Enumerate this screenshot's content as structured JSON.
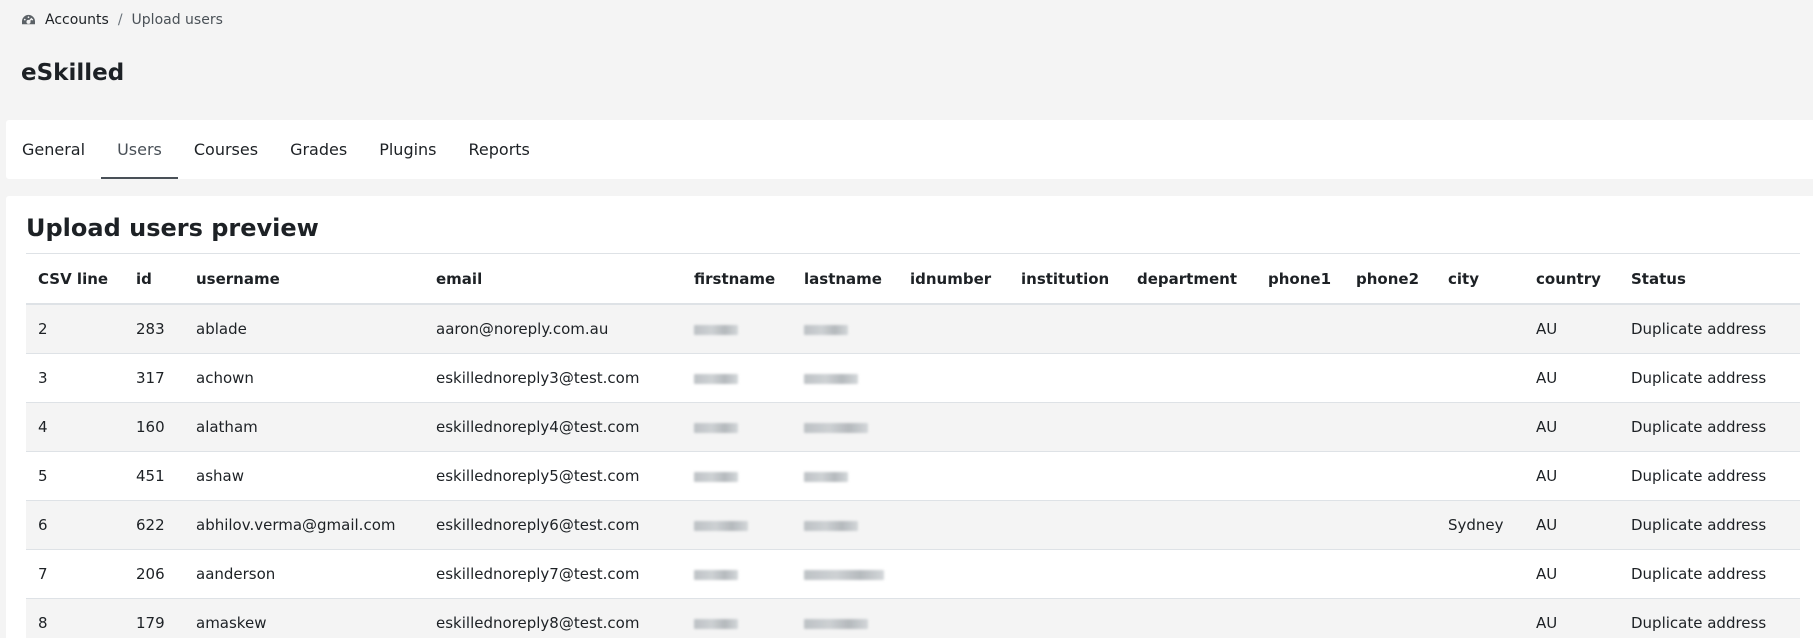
{
  "breadcrumb": {
    "icon": "dashboard-icon",
    "items": [
      "Accounts",
      "Upload users"
    ],
    "separator": "/"
  },
  "page": {
    "title": "eSkilled"
  },
  "tabs": [
    {
      "label": "General",
      "active": false
    },
    {
      "label": "Users",
      "active": true
    },
    {
      "label": "Courses",
      "active": false
    },
    {
      "label": "Grades",
      "active": false
    },
    {
      "label": "Plugins",
      "active": false
    },
    {
      "label": "Reports",
      "active": false
    }
  ],
  "preview": {
    "title": "Upload users preview",
    "columns": [
      "CSV line",
      "id",
      "username",
      "email",
      "firstname",
      "lastname",
      "idnumber",
      "institution",
      "department",
      "phone1",
      "phone2",
      "city",
      "country",
      "Status"
    ],
    "rows": [
      {
        "csv_line": "2",
        "id": "283",
        "username": "ablade",
        "email": "aaron@noreply.com.au",
        "city": "",
        "country": "AU",
        "status": "Duplicate address"
      },
      {
        "csv_line": "3",
        "id": "317",
        "username": "achown",
        "email": "eskillednoreply3@test.com",
        "city": "",
        "country": "AU",
        "status": "Duplicate address"
      },
      {
        "csv_line": "4",
        "id": "160",
        "username": "alatham",
        "email": "eskillednoreply4@test.com",
        "city": "",
        "country": "AU",
        "status": "Duplicate address"
      },
      {
        "csv_line": "5",
        "id": "451",
        "username": "ashaw",
        "email": "eskillednoreply5@test.com",
        "city": "",
        "country": "AU",
        "status": "Duplicate address"
      },
      {
        "csv_line": "6",
        "id": "622",
        "username": "abhilov.verma@gmail.com",
        "email": "eskillednoreply6@test.com",
        "city": "Sydney",
        "country": "AU",
        "status": "Duplicate address"
      },
      {
        "csv_line": "7",
        "id": "206",
        "username": "aanderson",
        "email": "eskillednoreply7@test.com",
        "city": "",
        "country": "AU",
        "status": "Duplicate address"
      },
      {
        "csv_line": "8",
        "id": "179",
        "username": "amaskew",
        "email": "eskillednoreply8@test.com",
        "city": "",
        "country": "AU",
        "status": "Duplicate address"
      }
    ]
  },
  "colors": {
    "page_background": "#f4f4f4",
    "panel_background": "#ffffff",
    "stripe_background": "#f4f4f4",
    "border": "#dee2e6",
    "text": "#1d2125"
  }
}
